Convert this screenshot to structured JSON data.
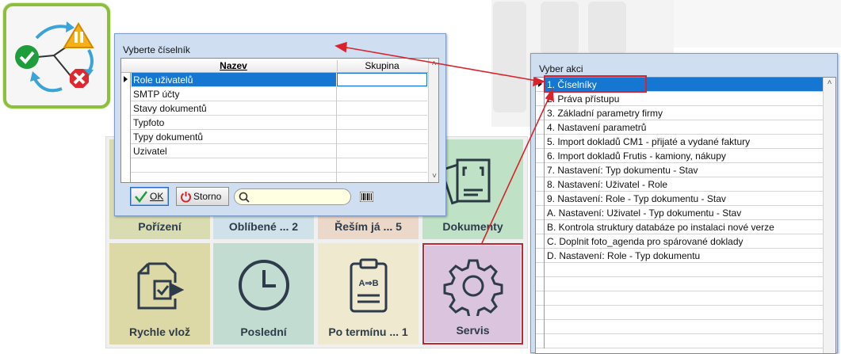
{
  "logo": {
    "icon": "status-cycle-icon",
    "colors": {
      "frame": "#8cbf3c",
      "ok": "#1e9e3b",
      "warn": "#f5b017",
      "error": "#e0262e",
      "arrows": "#3aa3d8"
    }
  },
  "tiles": [
    {
      "label": "Pořízení",
      "bg": "#d8dcb0"
    },
    {
      "label": "Oblíbené ... 2",
      "bg": "#cfe2ea"
    },
    {
      "label": "Řeším já   ... 5",
      "bg": "#ecd8c8"
    },
    {
      "label": "Dokumenty",
      "bg": "#bfe2c6",
      "icon": "documents-icon"
    },
    {
      "label": "Rychle vlož",
      "bg": "#ddd9a6",
      "icon": "document-import-icon"
    },
    {
      "label": "Poslední",
      "bg": "#c2dcd2",
      "icon": "clock-icon"
    },
    {
      "label": "Po termínu ... 1",
      "bg": "#eee9cf",
      "icon": "clipboard-icon"
    },
    {
      "label": "Servis",
      "bg": "#dbc4dd",
      "icon": "gear-icon"
    }
  ],
  "dialog_ciselnik": {
    "title": "Vyberte číselník",
    "columns": [
      "Nazev",
      "Skupina"
    ],
    "rows": [
      "Role uživatelů",
      "SMTP účty",
      "Stavy dokumentů",
      "Typfoto",
      "Typy dokumentů",
      "Uzivatel"
    ],
    "selected_index": 0,
    "ok_label": "OK",
    "cancel_label": "Storno",
    "search_value": ""
  },
  "dialog_akce": {
    "title": "Vyber akci",
    "items": [
      "1. Číselníky",
      "2. Práva přístupu",
      "3. Základní parametry firmy",
      "4. Nastavení parametrů",
      "5. Import dokladů CM1 - přijaté a vydané faktury",
      "6. Import dokladů Frutis - kamiony, nákupy",
      "7. Nastavení: Typ dokumentu - Stav",
      "8. Nastavení: Uživatel - Role",
      "9. Nastavení: Role - Typ dokumentu - Stav",
      "A. Nastavení: Uživatel - Typ dokumentu - Stav",
      "B. Kontrola struktury databáze po instalaci nové verze",
      "C. Doplnit foto_agenda pro spárované doklady",
      "D. Nastavení: Role - Typ dokumentu"
    ],
    "selected_index": 0
  },
  "accent": {
    "selection": "#1577d1",
    "callout": "#d9232d"
  }
}
